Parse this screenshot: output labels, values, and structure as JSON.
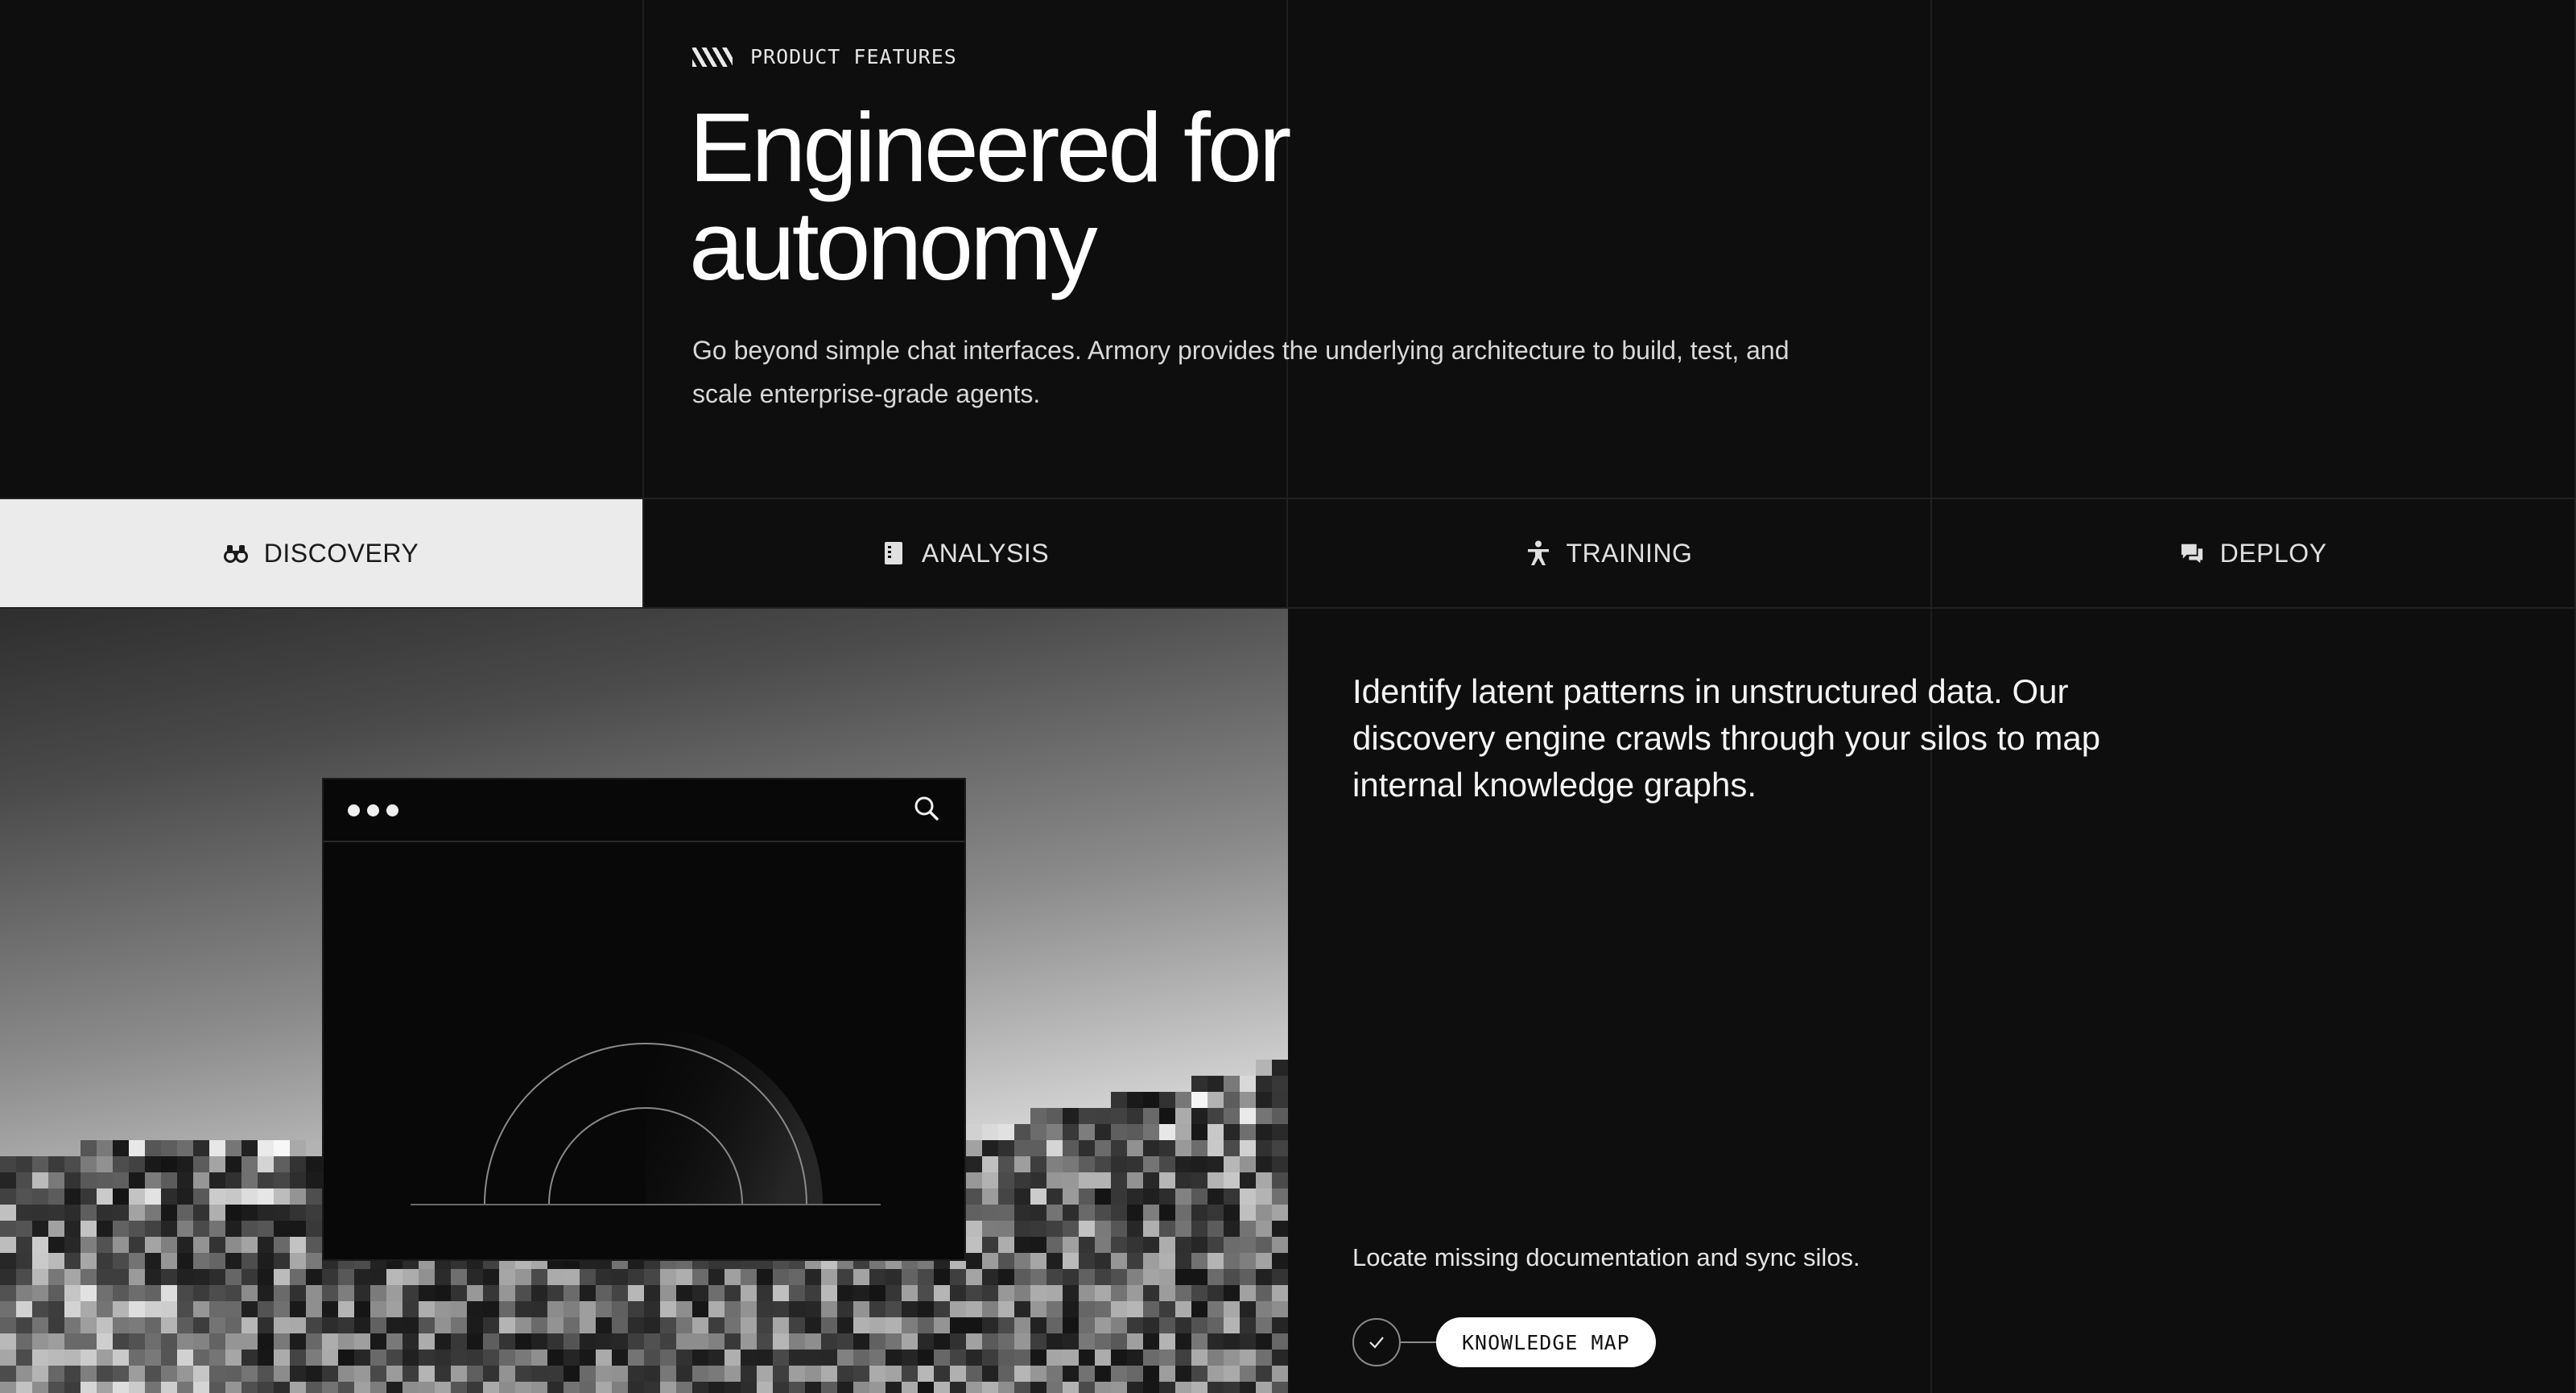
{
  "header": {
    "eyebrow": "PRODUCT FEATURES",
    "title_line1": "Engineered for",
    "title_line2": "autonomy",
    "subtitle": "Go beyond simple chat interfaces. Armory provides the underlying architecture to build, test, and scale enterprise-grade agents."
  },
  "tabs": [
    {
      "label": "DISCOVERY",
      "icon": "binoculars-icon",
      "active": true
    },
    {
      "label": "ANALYSIS",
      "icon": "document-icon",
      "active": false
    },
    {
      "label": "TRAINING",
      "icon": "person-icon",
      "active": false
    },
    {
      "label": "DEPLOY",
      "icon": "chat-bubbles-icon",
      "active": false
    }
  ],
  "panel": {
    "description": "Identify latent patterns in unstructured data. Our discovery engine crawls through your silos to map internal knowledge graphs.",
    "caption": "Locate missing documentation and sync silos.",
    "chip_label": "KNOWLEDGE MAP"
  },
  "colors": {
    "background": "#0e0e0e",
    "active_tab": "#ebebeb",
    "text": "#f2f2f2"
  }
}
